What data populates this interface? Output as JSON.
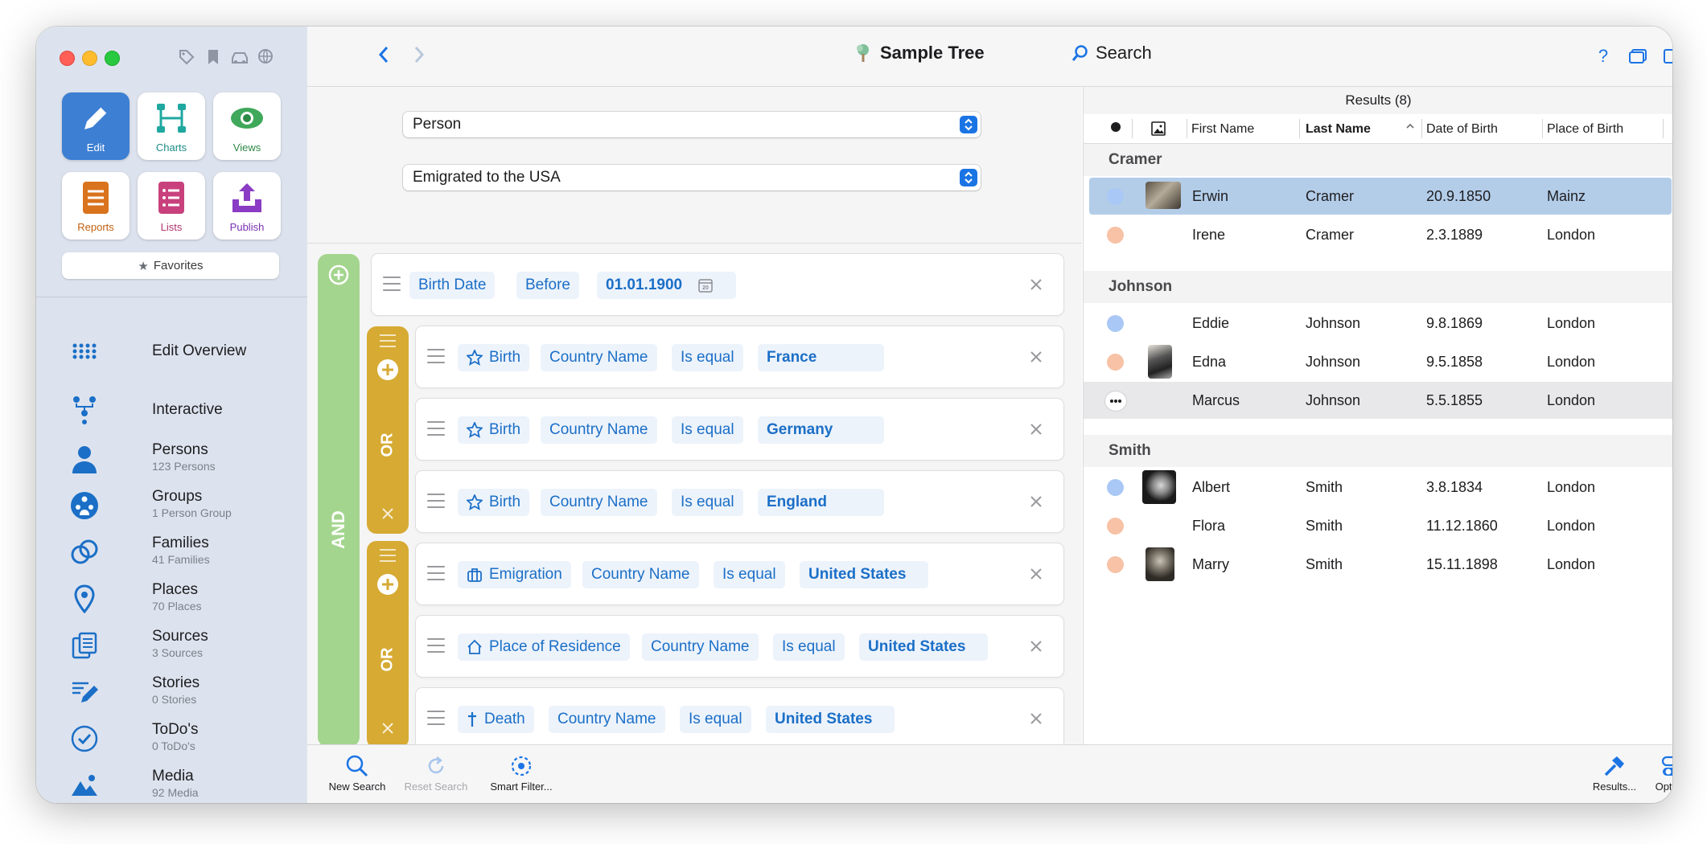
{
  "toolbar": {
    "title": "Sample Tree",
    "search_label": "Search"
  },
  "sidebar": {
    "buttons": [
      {
        "label": "Edit"
      },
      {
        "label": "Charts"
      },
      {
        "label": "Views"
      },
      {
        "label": "Reports"
      },
      {
        "label": "Lists"
      },
      {
        "label": "Publish"
      }
    ],
    "favorites_label": "Favorites",
    "items": [
      {
        "label": "Edit Overview"
      },
      {
        "label": "Interactive"
      },
      {
        "label": "Persons",
        "sub": "123 Persons"
      },
      {
        "label": "Groups",
        "sub": "1 Person Group"
      },
      {
        "label": "Families",
        "sub": "41 Families"
      },
      {
        "label": "Places",
        "sub": "70 Places"
      },
      {
        "label": "Sources",
        "sub": "3 Sources"
      },
      {
        "label": "Stories",
        "sub": "0 Stories"
      },
      {
        "label": "ToDo's",
        "sub": "0 ToDo's"
      },
      {
        "label": "Media",
        "sub": "92 Media"
      }
    ]
  },
  "search": {
    "entity_select": "Person",
    "preset_select": "Emigrated to the USA",
    "and_label": "AND",
    "or_label": "OR",
    "rules": [
      {
        "field": "Birth Date",
        "op": "Before",
        "value": "01.01.1900"
      },
      {
        "event": "Birth",
        "field": "Country Name",
        "op": "Is equal",
        "value": "France"
      },
      {
        "event": "Birth",
        "field": "Country Name",
        "op": "Is equal",
        "value": "Germany"
      },
      {
        "event": "Birth",
        "field": "Country Name",
        "op": "Is equal",
        "value": "England"
      },
      {
        "event": "Emigration",
        "field": "Country Name",
        "op": "Is equal",
        "value": "United States"
      },
      {
        "event": "Place of Residence",
        "field": "Country Name",
        "op": "Is equal",
        "value": "United States"
      },
      {
        "event": "Death",
        "field": "Country Name",
        "op": "Is equal",
        "value": "United States"
      }
    ]
  },
  "results": {
    "header": "Results (8)",
    "columns": [
      "First Name",
      "Last Name",
      "Date of Birth",
      "Place of Birth"
    ],
    "groups": [
      {
        "name": "Cramer",
        "rows": [
          {
            "first": "Erwin",
            "last": "Cramer",
            "dob": "20.9.1850",
            "pob": "Mainz"
          },
          {
            "first": "Irene",
            "last": "Cramer",
            "dob": "2.3.1889",
            "pob": "London"
          }
        ]
      },
      {
        "name": "Johnson",
        "rows": [
          {
            "first": "Eddie",
            "last": "Johnson",
            "dob": "9.8.1869",
            "pob": "London"
          },
          {
            "first": "Edna",
            "last": "Johnson",
            "dob": "9.5.1858",
            "pob": "London"
          },
          {
            "first": "Marcus",
            "last": "Johnson",
            "dob": "5.5.1855",
            "pob": "London"
          }
        ]
      },
      {
        "name": "Smith",
        "rows": [
          {
            "first": "Albert",
            "last": "Smith",
            "dob": "3.8.1834",
            "pob": "London"
          },
          {
            "first": "Flora",
            "last": "Smith",
            "dob": "11.12.1860",
            "pob": "London"
          },
          {
            "first": "Marry",
            "last": "Smith",
            "dob": "15.11.1898",
            "pob": "London"
          }
        ]
      }
    ]
  },
  "bottombar": {
    "new_search": "New Search",
    "reset_search": "Reset Search",
    "smart_filter": "Smart Filter...",
    "results": "Results...",
    "options": "Options"
  },
  "colors": {
    "accent": "#1b74e4",
    "and_bar": "#a4d58e",
    "or_bar": "#d6aa33",
    "male": "#a9c8f5",
    "female": "#f7c2a5",
    "selection": "#b3cde9"
  }
}
